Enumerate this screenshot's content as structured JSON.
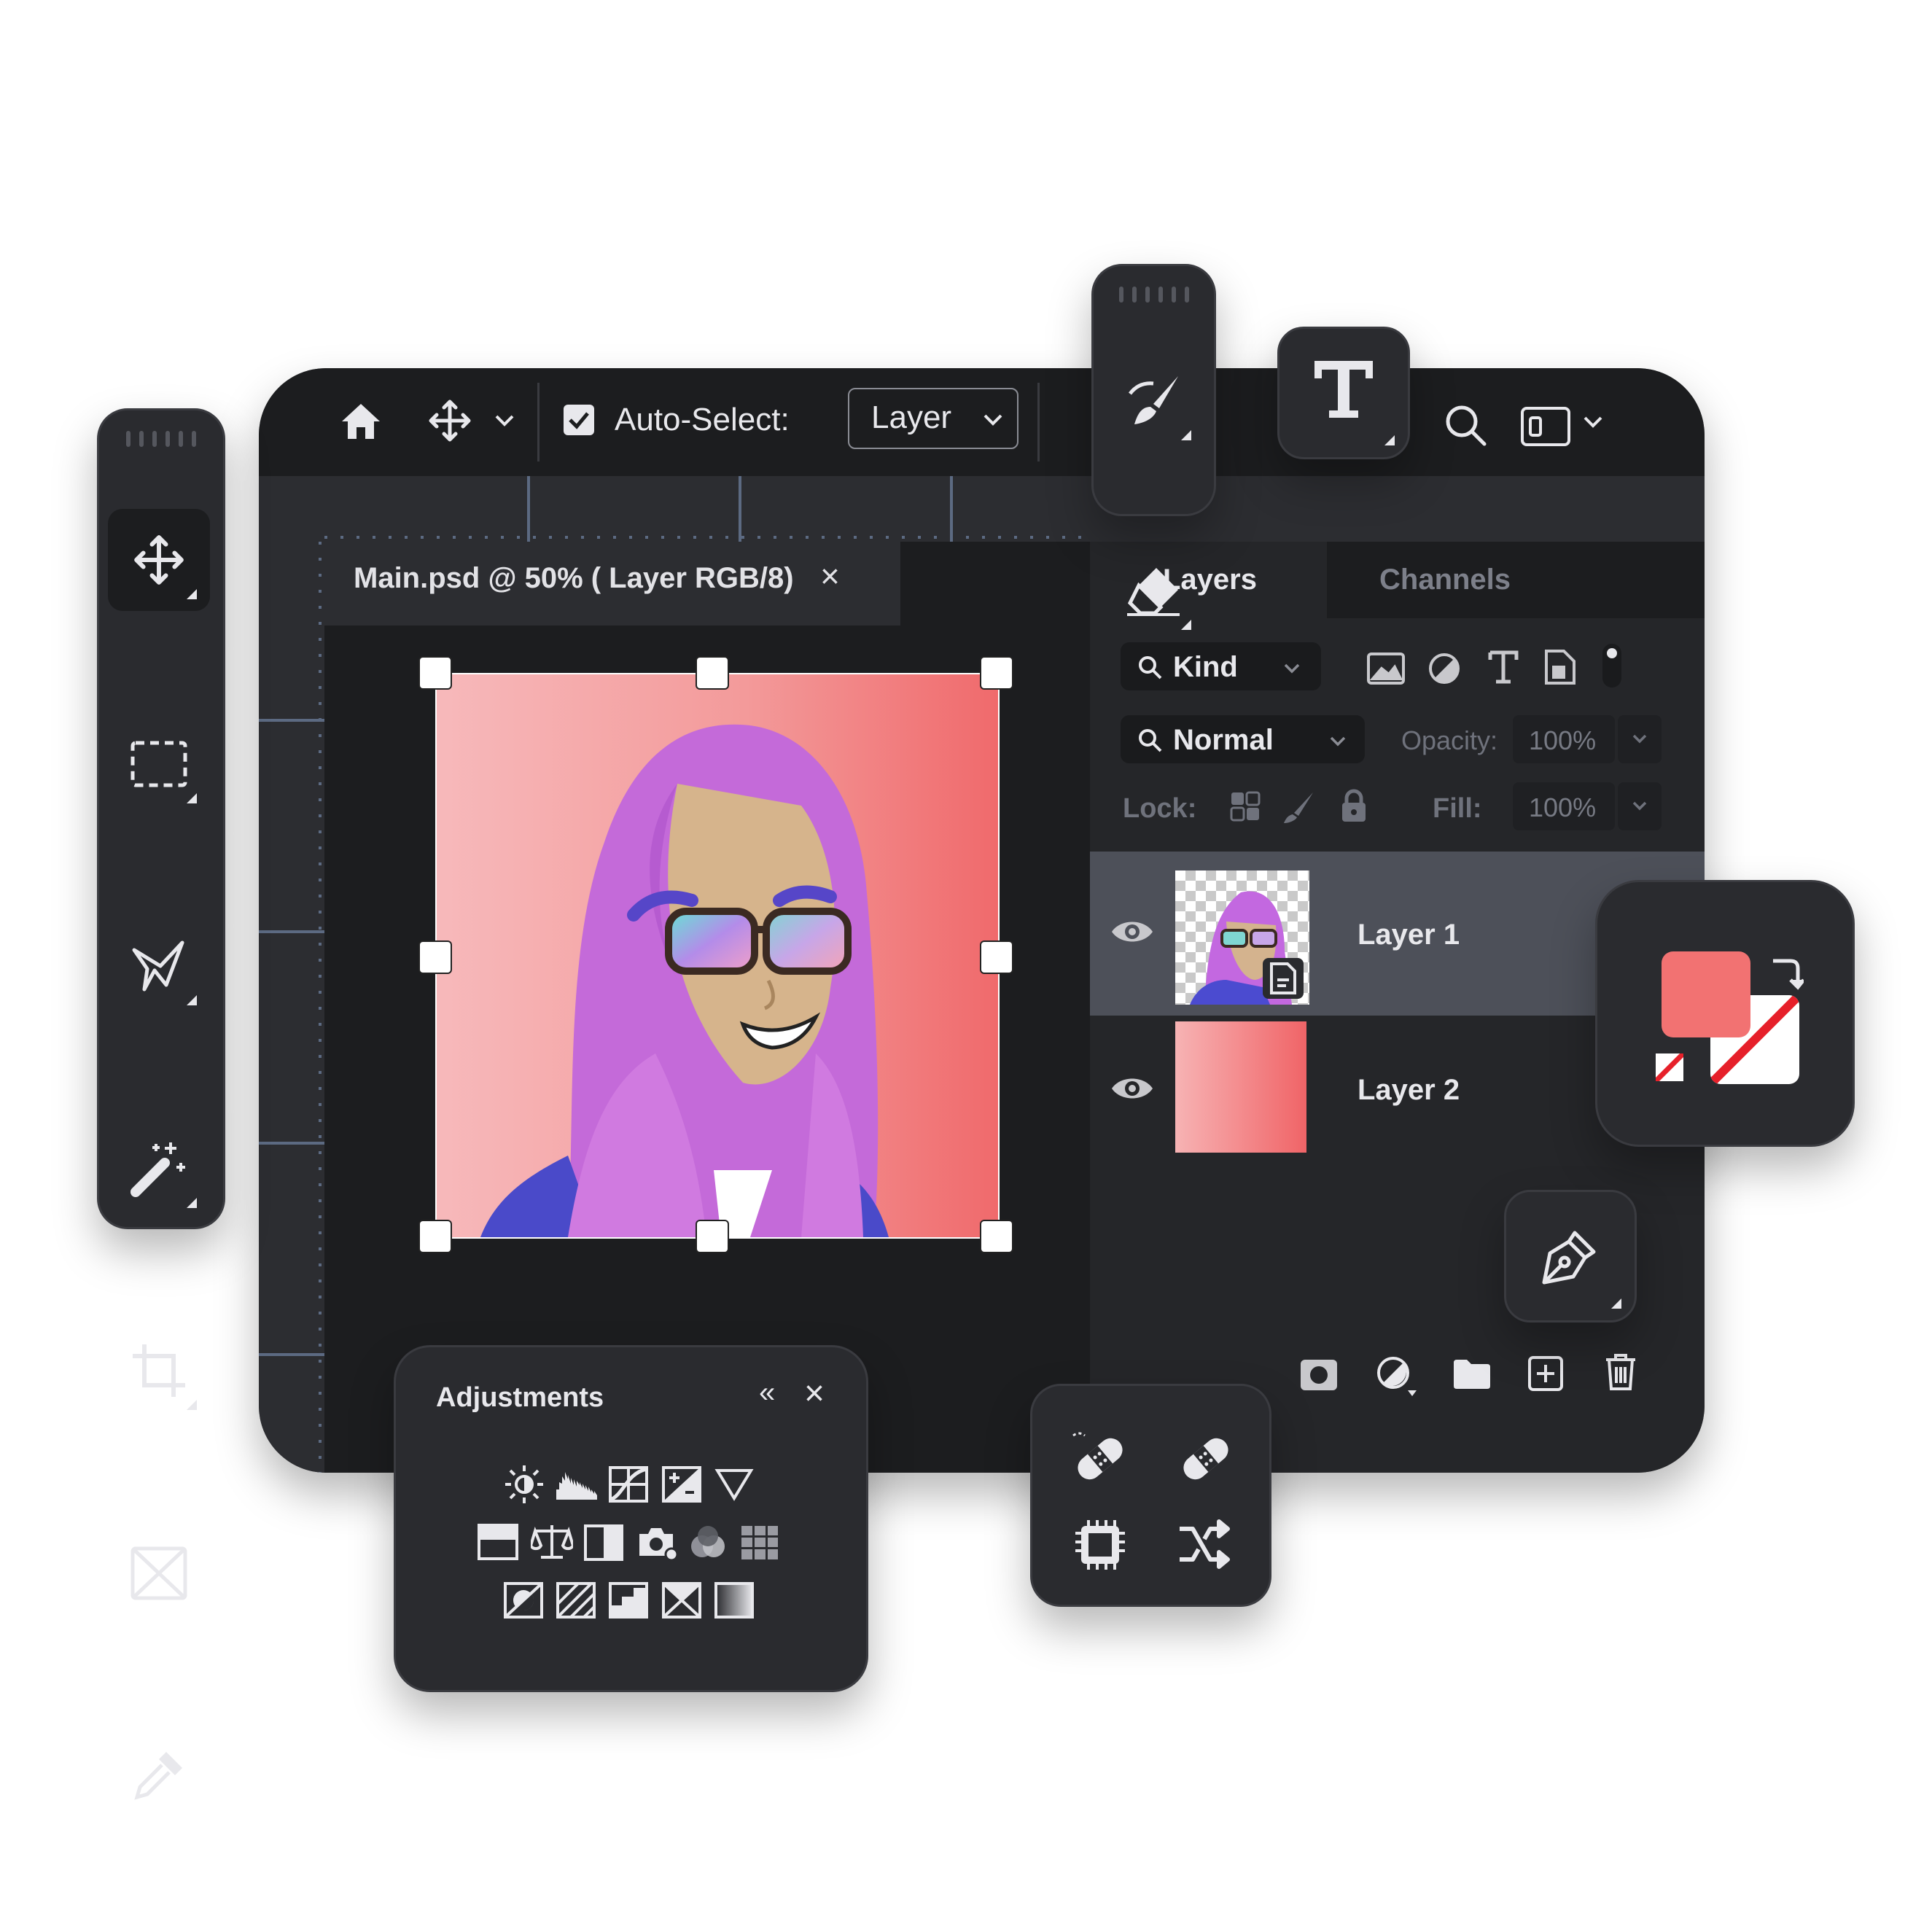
{
  "toolbar": {
    "auto_select_label": "Auto-Select:",
    "auto_select_checked": true,
    "layer_dropdown_value": "Layer"
  },
  "document": {
    "tab_title": "Main.psd @ 50% ( Layer RGB/8)",
    "close_glyph": "×"
  },
  "layers_panel": {
    "tabs": [
      "Layers",
      "Channels"
    ],
    "kind_filter": "Kind",
    "blend_mode": "Normal",
    "opacity_label": "Opacity:",
    "opacity_value": "100%",
    "lock_label": "Lock:",
    "fill_label": "Fill:",
    "fill_value": "100%",
    "layers": [
      {
        "name": "Layer 1",
        "selected": true,
        "visible": true
      },
      {
        "name": "Layer 2",
        "selected": false,
        "visible": true
      }
    ]
  },
  "adjustments": {
    "title": "Adjustments",
    "collapse_glyph": "«",
    "close_glyph": "×"
  },
  "icons": {
    "left_toolbar": [
      "move-tool-icon",
      "marquee-tool-icon",
      "lasso-tool-icon",
      "magic-wand-icon",
      "crop-tool-icon",
      "frame-tool-icon",
      "eyedropper-icon"
    ],
    "topbar": [
      "home-icon",
      "move-icon",
      "search-icon",
      "workspace-icon"
    ],
    "panel_footer": [
      "mask-icon",
      "adjustment-layer-icon",
      "folder-icon",
      "new-layer-icon",
      "trash-icon"
    ]
  },
  "colors": {
    "accent": "#f27272",
    "window_bg": "#252629",
    "selected_layer_bg": "#4d5059"
  }
}
